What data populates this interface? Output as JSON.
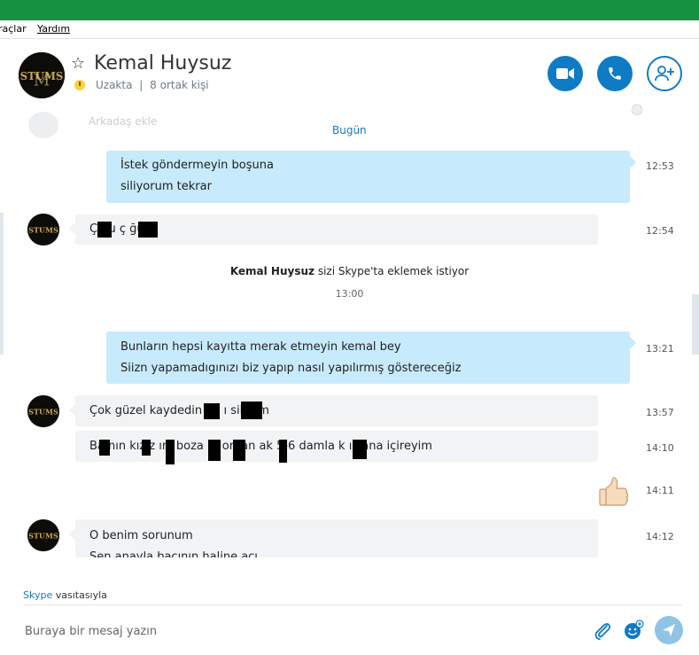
{
  "menu": {
    "items": [
      "raçlar",
      "Yardım"
    ]
  },
  "contact": {
    "name": "Kemal Huysuz",
    "status": "Uzakta",
    "separator": "|",
    "mutual": "8 ortak kişi"
  },
  "chat": {
    "partial_top": "Arkadaş ekle",
    "date_label": "Bugün",
    "messages": [
      {
        "id": "m1",
        "side": "out",
        "lines": [
          "İstek göndermeyin boşuna",
          "siliyorum tekrar"
        ],
        "time": "12:53"
      },
      {
        "id": "m2",
        "side": "in",
        "lines": [
          "Ç     bu ç      ğu"
        ],
        "time": "12:54"
      },
      {
        "id": "m3",
        "side": "out",
        "lines": [
          "Bunların hepsi kayıtta merak etmeyin kemal bey",
          "Siizn yapamadıgınızı biz yapıp nasıl yapılırmış göstereceğiz"
        ],
        "time": "13:21"
      },
      {
        "id": "m4",
        "side": "in",
        "lines": [
          "Çok güzel kaydedin an      ı sik       rim"
        ],
        "time": "13:57"
      },
      {
        "id": "m5",
        "side": "in",
        "lines": [
          "Ba   nın kız   z   ını boza     m ordan ak    5-6 damla k    ı sana içireyim"
        ],
        "time": "14:10"
      },
      {
        "id": "m6",
        "side": "out",
        "emoji": "thumbs-up",
        "time": "14:11"
      },
      {
        "id": "m7",
        "side": "in",
        "lines": [
          "O benim sorunum",
          "Sen anayla bacının haline acı"
        ],
        "time": "14:12"
      }
    ],
    "system": {
      "name": "Kemal Huysuz",
      "text": " sizi Skype'ta eklemek istiyor",
      "time": "13:00"
    }
  },
  "footer": {
    "via_brand": "Skype",
    "via_text": " vasıtasıyla",
    "input_placeholder": "Buraya bir mesaj yazın"
  },
  "colors": {
    "topbar": "#169140",
    "accent": "#0f7bc4",
    "bubble_out": "#c7eafc",
    "bubble_in": "#f1f3f5"
  }
}
